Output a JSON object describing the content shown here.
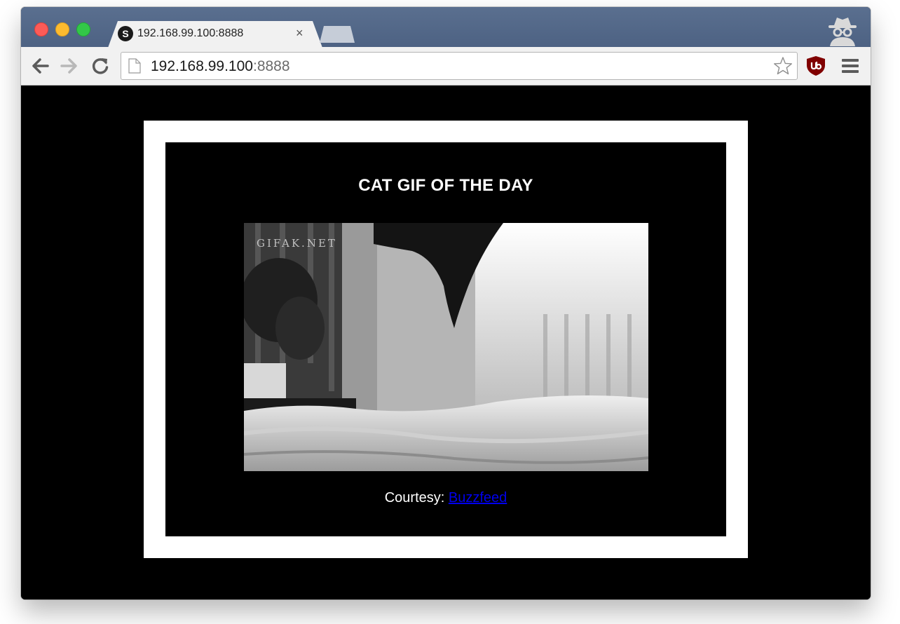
{
  "browser": {
    "tab": {
      "favicon_letter": "S",
      "title": "192.168.99.100:8888",
      "close_glyph": "×"
    },
    "address": {
      "host": "192.168.99.100",
      "port": ":8888"
    },
    "icons": {
      "back": "back-arrow-icon",
      "forward": "forward-arrow-icon",
      "reload": "reload-icon",
      "bookmark": "star-icon",
      "extension": "ublock-origin-icon",
      "menu": "hamburger-menu-icon",
      "profile": "incognito-icon"
    }
  },
  "page": {
    "heading": "CAT GIF OF THE DAY",
    "gif_watermark": "GIFAK.NET",
    "credit_label": "Courtesy: ",
    "credit_link": "Buzzfeed"
  },
  "colors": {
    "titlebar": "#566b8b",
    "page_background": "#000000",
    "frame": "#ffffff",
    "link": "#0000ee"
  }
}
